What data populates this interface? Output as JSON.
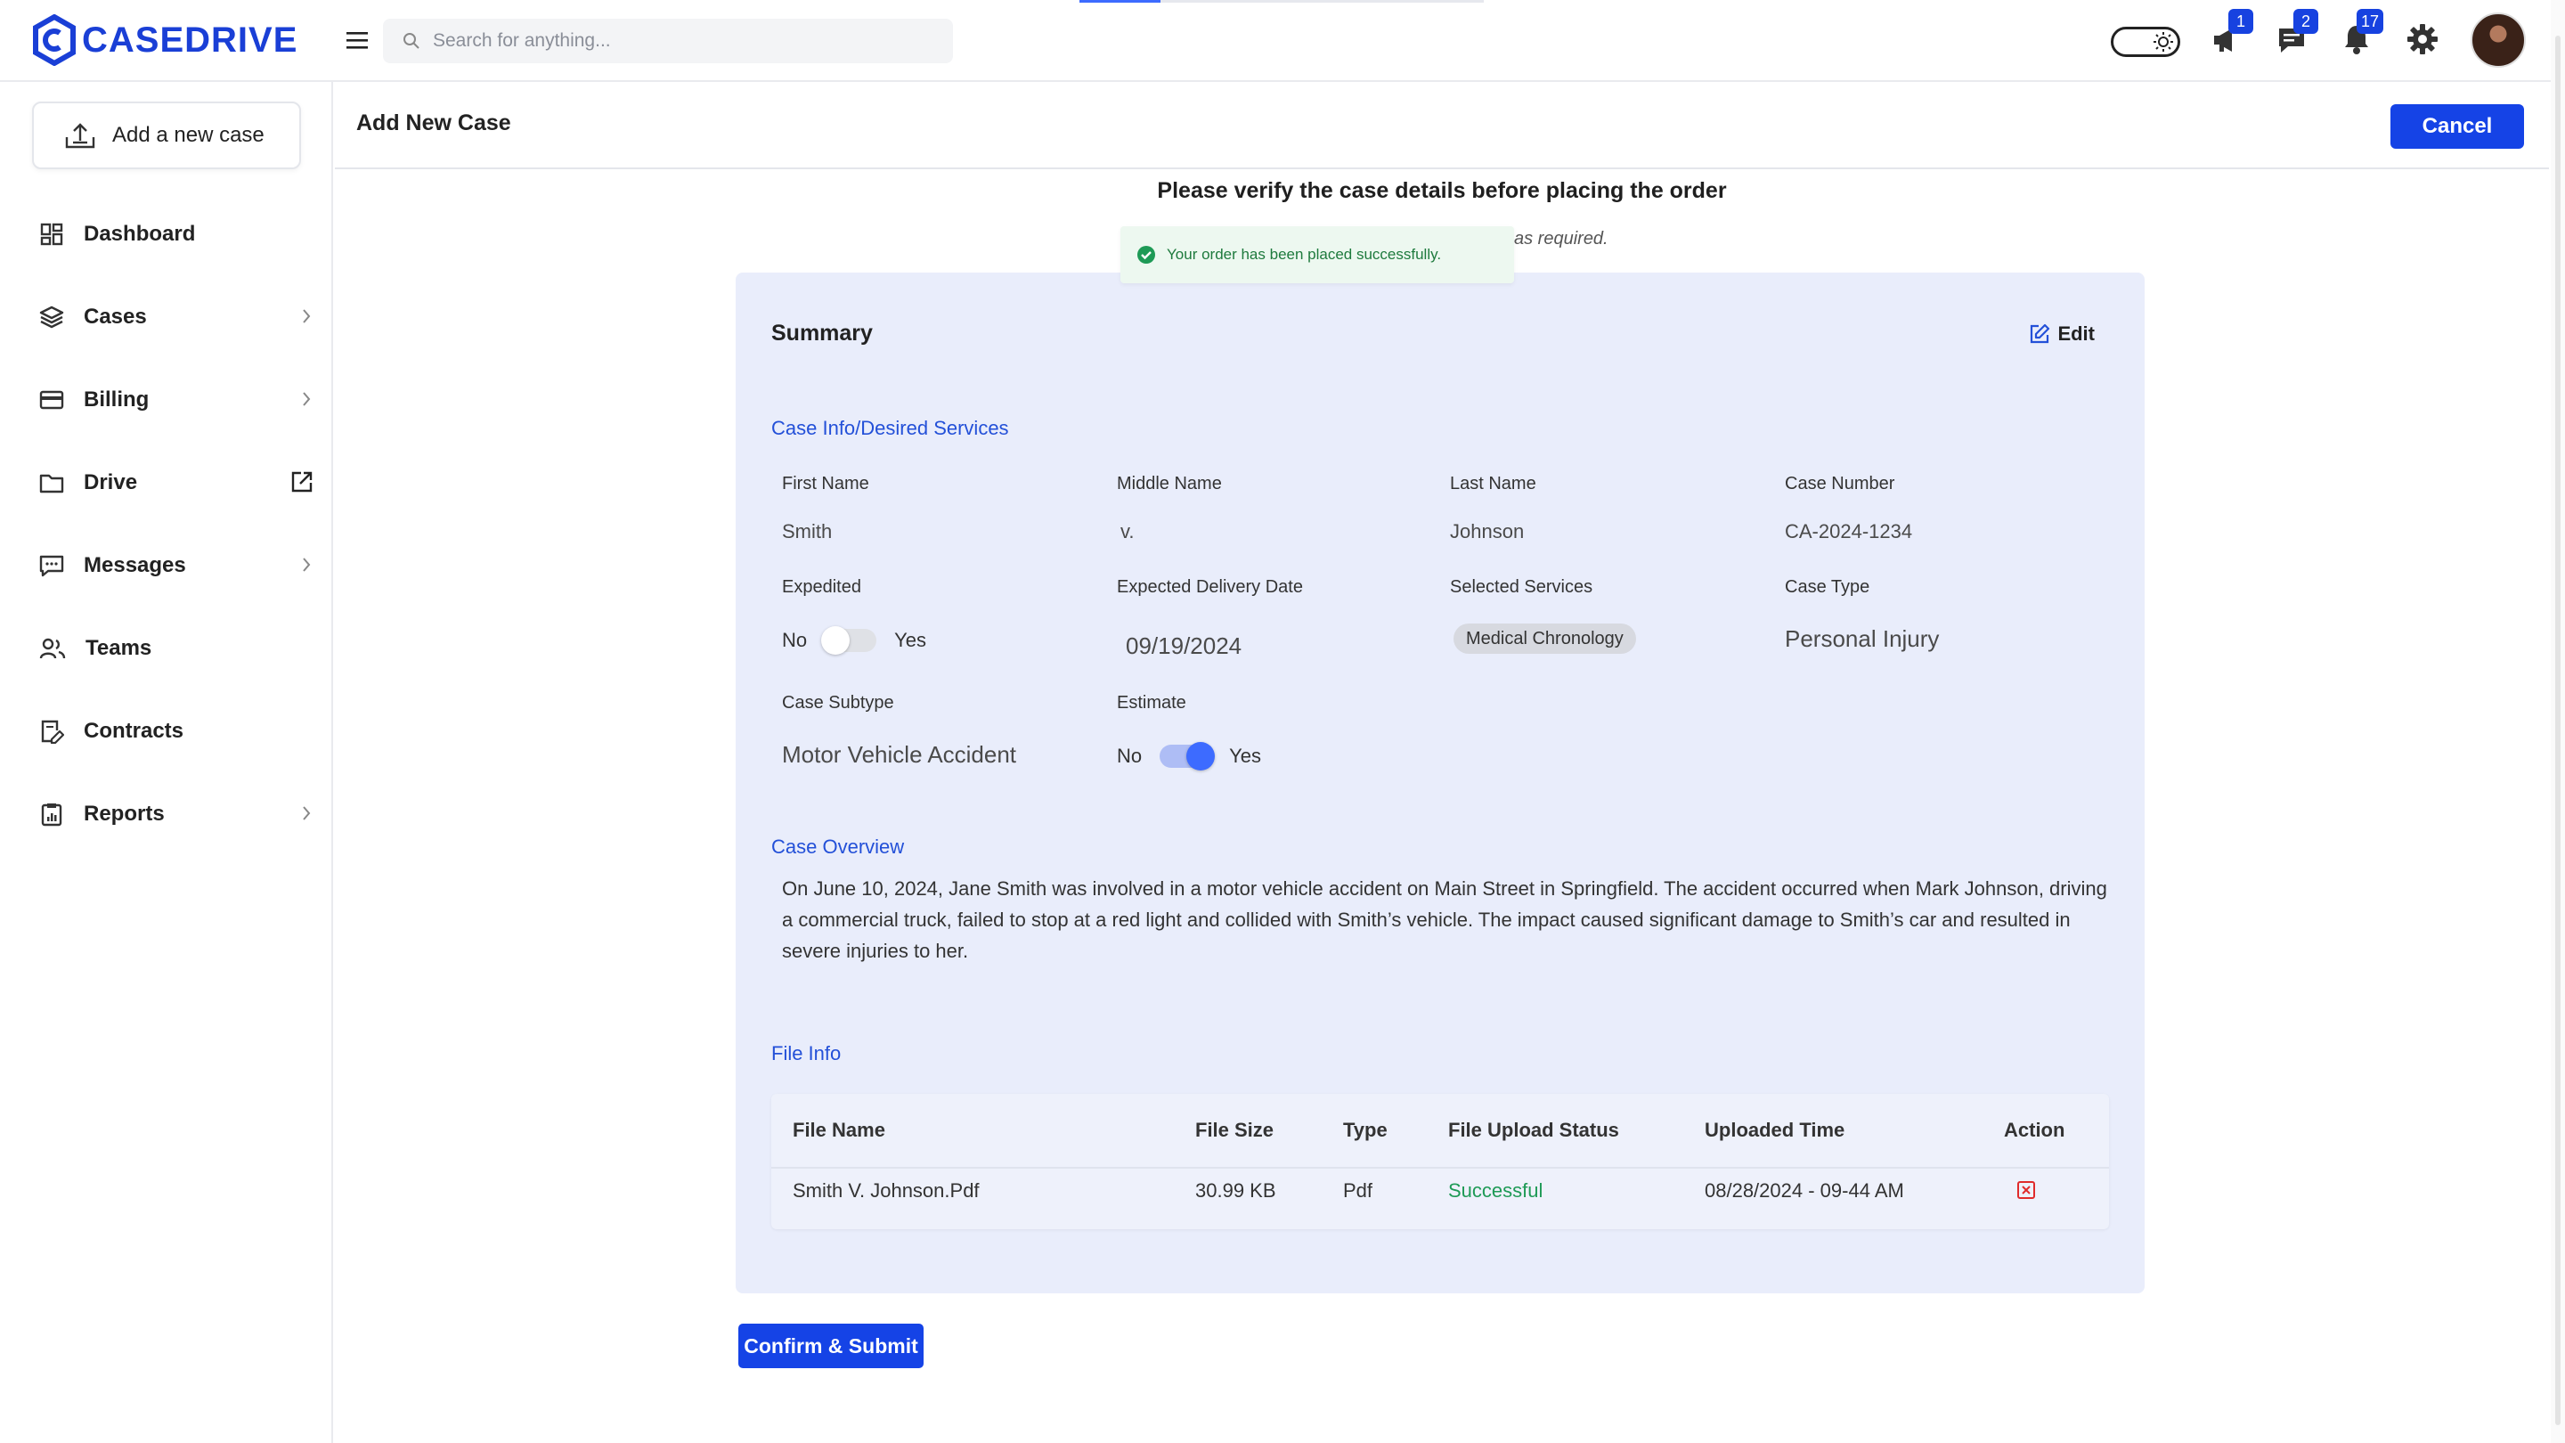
{
  "brand": {
    "name": "CASEDRIVE",
    "color": "#1a3fd6"
  },
  "topbar": {
    "search_placeholder": "Search for anything...",
    "upload_progress": 0.2,
    "badges": {
      "announcements": "1",
      "messages": "2",
      "notifications": "17"
    }
  },
  "sidebar": {
    "add_case_label": "Add a new case",
    "items": [
      {
        "label": "Dashboard",
        "icon": "dashboard-icon"
      },
      {
        "label": "Cases",
        "icon": "layers-icon"
      },
      {
        "label": "Billing",
        "icon": "credit-card-icon"
      },
      {
        "label": "Drive",
        "icon": "folder-icon"
      },
      {
        "label": "Messages",
        "icon": "message-icon"
      },
      {
        "label": "Teams",
        "icon": "users-icon"
      },
      {
        "label": "Contracts",
        "icon": "contract-icon"
      },
      {
        "label": "Reports",
        "icon": "report-icon"
      }
    ]
  },
  "header": {
    "title": "Add New Case",
    "cancel_label": "Cancel"
  },
  "verify": {
    "title": "Please verify the case details before placing the order",
    "note": "as required.",
    "toast": "Your order has been placed successfully."
  },
  "summary": {
    "title": "Summary",
    "edit_label": "Edit",
    "case_info_title": "Case Info/Desired Services",
    "fields": {
      "first_name_label": "First Name",
      "first_name": "Smith",
      "middle_name_label": "Middle Name",
      "middle_name": "v.",
      "last_name_label": "Last Name",
      "last_name": "Johnson",
      "case_number_label": "Case Number",
      "case_number": "CA-2024-1234",
      "expedited_label": "Expedited",
      "expedited_no": "No",
      "expedited_yes": "Yes",
      "delivery_label": "Expected Delivery Date",
      "delivery_date": "09/19/2024",
      "services_label": "Selected Services",
      "service": "Medical Chronology",
      "case_type_label": "Case Type",
      "case_type": "Personal Injury",
      "subtype_label": "Case Subtype",
      "subtype": "Motor Vehicle Accident",
      "estimate_label": "Estimate",
      "estimate_no": "No",
      "estimate_yes": "Yes"
    },
    "overview_title": "Case Overview",
    "overview_text": "On June 10, 2024, Jane Smith was involved in a motor vehicle accident on Main Street in Springfield. The accident occurred when Mark Johnson, driving a commercial truck, failed to stop at a red light and collided with Smith’s vehicle. The impact caused significant damage to Smith’s car and resulted in severe injuries to her.",
    "file_info_title": "File Info",
    "table": {
      "headers": [
        "File Name",
        "File Size",
        "Type",
        "File Upload Status",
        "Uploaded Time",
        "Action"
      ],
      "rows": [
        {
          "name": "Smith V. Johnson.Pdf",
          "size": "30.99 KB",
          "type": "Pdf",
          "status": "Successful",
          "time": "08/28/2024 - 09-44 AM"
        }
      ]
    }
  },
  "confirm_label": "Confirm & Submit",
  "colors": {
    "primary": "#1543e6",
    "card_bg": "#e9edfb",
    "link": "#2350d8",
    "success": "#1e9a56",
    "danger": "#e02b2b"
  }
}
